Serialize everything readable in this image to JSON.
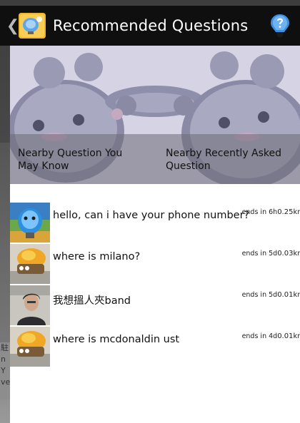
{
  "app": {
    "title": "Recommended Questions",
    "back_glyph": "❮"
  },
  "tabs": [
    {
      "label": "Nearby Question You May Know"
    },
    {
      "label": "Nearby Recently Asked Question"
    }
  ],
  "questions": [
    {
      "text": "hello, can i have your phone number?",
      "ends": "ends in 6h",
      "distance": "0.25km",
      "avatar": "bulb-avatar"
    },
    {
      "text": "where is milano?",
      "ends": "ends in 5d",
      "distance": "0.03km",
      "avatar": "food-avatar"
    },
    {
      "text": "我想搵人夾band",
      "ends": "ends in 5d",
      "distance": "0.01km",
      "avatar": "person-avatar"
    },
    {
      "text": "where is mcdonaldin ust",
      "ends": "ends in 4d",
      "distance": "0.01km",
      "avatar": "food-avatar"
    }
  ],
  "background_strip": {
    "lines": [
      "駐",
      "n Y",
      "ve"
    ]
  },
  "colors": {
    "action_bar": "#0f0f10",
    "banner": "#d4d2e2",
    "panel": "#ffffff",
    "bulb_blue": "#3d8fe0"
  }
}
